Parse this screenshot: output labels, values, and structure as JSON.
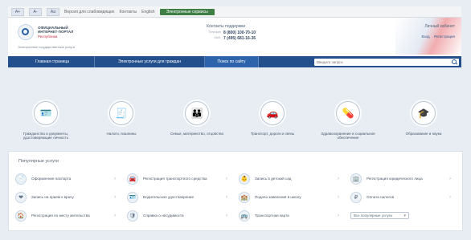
{
  "top_bar": {
    "mini_buttons": [
      "А+",
      "А-",
      "Аа"
    ],
    "links": [
      "Версия для слабовидящих",
      "Контакты",
      "English"
    ],
    "promo_label": "Электронные сервисы"
  },
  "header": {
    "logo": {
      "line1": "Официальный",
      "line2": "интернет-портал",
      "line3": "Республики"
    },
    "sub": "Электронные государственные услуги",
    "contacts": {
      "title": "Контакты поддержки",
      "rows": [
        {
          "label": "Телефон",
          "value": "8 (800) 100-70-10"
        },
        {
          "label": "Моб.",
          "value": "7 (495) 681-16-36"
        }
      ]
    },
    "account": {
      "name": "Личный кабинет",
      "links": [
        "Вход",
        "Регистрация"
      ]
    }
  },
  "nav": {
    "items": [
      {
        "label": "Главная страница",
        "active": false
      },
      {
        "label": "Электронные услуги для граждан",
        "active": false
      },
      {
        "label": "Поиск по сайту",
        "active": true
      }
    ],
    "search_placeholder": "Введите запрос"
  },
  "services": [
    {
      "icon": "passport-icon",
      "glyph": "🪪",
      "label": "Гражданство и документы, удостоверяющие личность"
    },
    {
      "icon": "tax-icon",
      "glyph": "🧾",
      "label": "Налоги, пошлины"
    },
    {
      "icon": "family-icon",
      "glyph": "👪",
      "label": "Семья, материнство, отцовство"
    },
    {
      "icon": "transport-icon",
      "glyph": "🚗",
      "label": "Транспорт, дороги и связь"
    },
    {
      "icon": "health-icon",
      "glyph": "💊",
      "label": "Здравоохранение и социальное обеспечение"
    },
    {
      "icon": "education-icon",
      "glyph": "🎓",
      "label": "Образование и наука"
    }
  ],
  "popular": {
    "title": "Популярные услуги",
    "items": [
      {
        "icon": "document-icon",
        "glyph": "📄",
        "label": "Оформление паспорта"
      },
      {
        "icon": "car-icon",
        "glyph": "🚘",
        "label": "Регистрация транспортного средства"
      },
      {
        "icon": "baby-icon",
        "glyph": "👶",
        "label": "Запись в детский сад"
      },
      {
        "icon": "building-icon",
        "glyph": "🏢",
        "label": "Регистрация юридического лица"
      },
      {
        "icon": "heart-icon",
        "glyph": "❤",
        "label": "Запись на прием к врачу"
      },
      {
        "icon": "license-icon",
        "glyph": "🪪",
        "label": "Водительское удостоверение"
      },
      {
        "icon": "school-icon",
        "glyph": "🏫",
        "label": "Подача заявления в школу"
      },
      {
        "icon": "money-icon",
        "glyph": "₽",
        "label": "Оплата налогов"
      },
      {
        "icon": "home-icon",
        "glyph": "🏠",
        "label": "Регистрация по месту жительства"
      },
      {
        "icon": "shield-icon",
        "glyph": "🛡",
        "label": "Справка о несудимости"
      },
      {
        "icon": "bus-icon",
        "glyph": "🚌",
        "label": "Транспортная карта"
      }
    ],
    "select_label": "Все популярные услуги"
  }
}
